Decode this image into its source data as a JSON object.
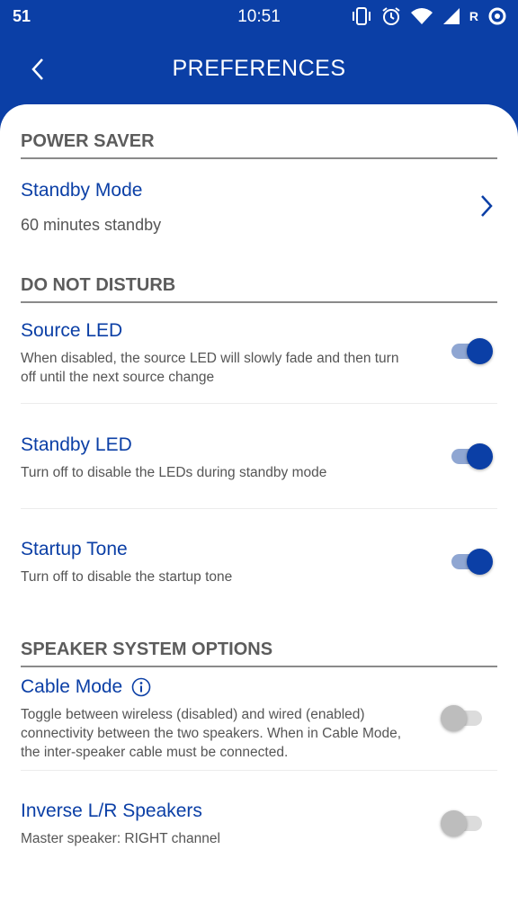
{
  "status_bar": {
    "left_text": "51",
    "time": "10:51",
    "carrier": "R",
    "icons": [
      "vibrate-icon",
      "alarm-icon",
      "wifi-icon",
      "signal-icon",
      "data-sync-icon"
    ]
  },
  "appbar": {
    "title": "PREFERENCES",
    "back_icon": "chevron-left-icon"
  },
  "colors": {
    "primary": "#0b3fa6",
    "toggle_on_track": "#8fa6d2",
    "toggle_off_thumb": "#bdbdbd"
  },
  "sections": {
    "power_saver": {
      "header": "POWER SAVER",
      "standby_mode": {
        "title": "Standby Mode",
        "value": "60 minutes standby"
      }
    },
    "do_not_disturb": {
      "header": "DO NOT DISTURB",
      "source_led": {
        "title": "Source LED",
        "description": "When disabled, the source LED will slowly fade and then turn off until the next source change",
        "enabled": true
      },
      "standby_led": {
        "title": "Standby LED",
        "description": "Turn off to disable the LEDs during standby mode",
        "enabled": true
      },
      "startup_tone": {
        "title": "Startup Tone",
        "description": "Turn off to disable the startup tone",
        "enabled": true
      }
    },
    "speaker_system": {
      "header": "SPEAKER SYSTEM OPTIONS",
      "cable_mode": {
        "title": "Cable Mode",
        "description": "Toggle between wireless (disabled) and wired (enabled) connectivity between the two speakers. When in Cable Mode, the inter-speaker cable must be connected.",
        "enabled": false
      },
      "inverse_lr": {
        "title": "Inverse L/R Speakers",
        "description": "Master speaker: RIGHT channel",
        "enabled": false
      }
    }
  }
}
